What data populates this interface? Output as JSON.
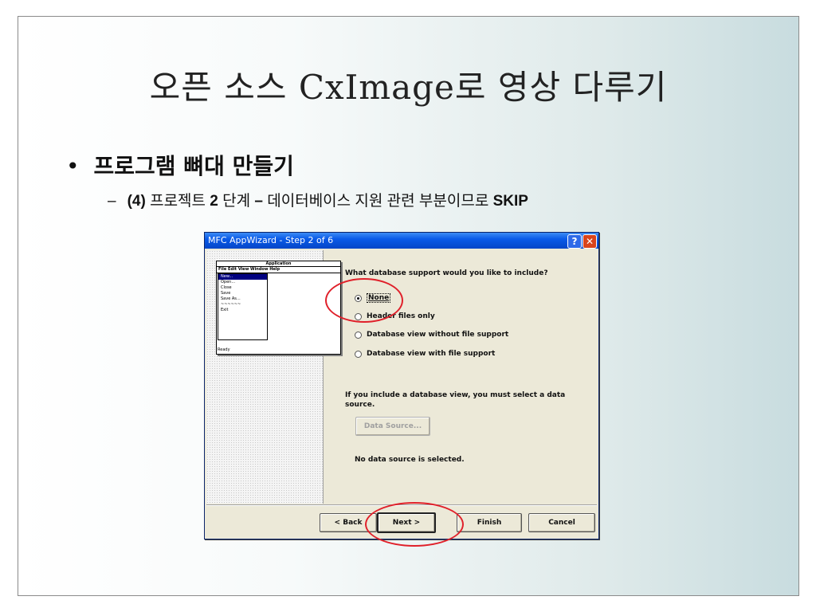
{
  "slide": {
    "title": "오픈 소스 CxImage로 영상 다루기",
    "bullet": "프로그램 뼈대 만들기",
    "bullet_marker": "•",
    "sub_dash": "–",
    "sub_prefix": "(4)",
    "sub_mid": " 프로젝트 ",
    "sub_num": "2",
    "sub_step": " 단계 ",
    "sub_dash2": "–",
    "sub_rest": " 데이터베이스 지원 관련 부분이므로 ",
    "sub_skip": "SKIP"
  },
  "dialog": {
    "title": "MFC AppWizard - Step 2 of 6",
    "help_glyph": "?",
    "close_glyph": "✕",
    "question": "What database support would you like to include?",
    "options": [
      {
        "label": "None",
        "checked": true
      },
      {
        "label": "Header files only",
        "checked": false
      },
      {
        "label": "Database view without file support",
        "checked": false
      },
      {
        "label": "Database view with file support",
        "checked": false
      }
    ],
    "info": "If you include a database view, you must select a data source.",
    "data_source_button": "Data Source...",
    "no_source": "No data source is selected.",
    "buttons": {
      "back": "< Back",
      "next": "Next >",
      "finish": "Finish",
      "cancel": "Cancel"
    }
  },
  "preview": {
    "app_title": "Application",
    "menubar": "File Edit View Window Help",
    "menu_items": [
      "New...",
      "Open...",
      "Close",
      "Save",
      "Save As...",
      "~~~~~~",
      "Exit"
    ],
    "status": "Ready"
  },
  "colors": {
    "titlebar": "#0a5ae8",
    "highlight": "#e0202a",
    "dialog_bg": "#ece9d8"
  }
}
